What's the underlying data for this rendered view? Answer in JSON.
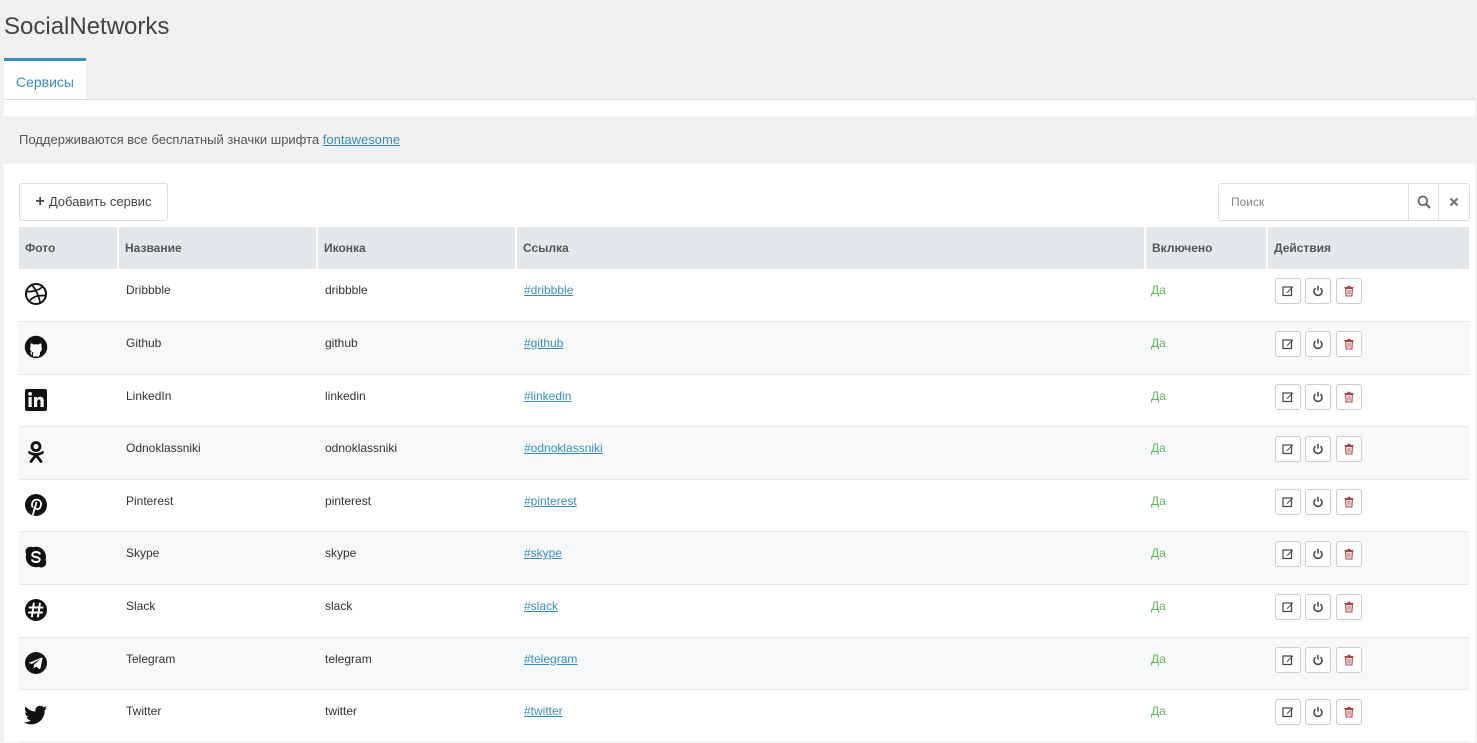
{
  "page": {
    "title": "SocialNetworks"
  },
  "tabs": [
    {
      "label": "Сервисы",
      "active": true
    }
  ],
  "notice": {
    "text": "Поддерживаются все бесплатный значки шрифта ",
    "link_text": "fontawesome"
  },
  "toolbar": {
    "add_label": "Добавить сервис",
    "search_placeholder": "Поиск"
  },
  "table": {
    "headers": [
      "Фото",
      "Название",
      "Иконка",
      "Ссылка",
      "Включено",
      "Действия"
    ],
    "rows": [
      {
        "icon": "dribbble-icon",
        "name": "Dribbble",
        "icon_name": "dribbble",
        "link": "#dribbble",
        "enabled": "Да"
      },
      {
        "icon": "github-icon",
        "name": "Github",
        "icon_name": "github",
        "link": "#github",
        "enabled": "Да"
      },
      {
        "icon": "linkedin-icon",
        "name": "LinkedIn",
        "icon_name": "linkedin",
        "link": "#linkedin",
        "enabled": "Да"
      },
      {
        "icon": "odnoklassniki-icon",
        "name": "Odnoklassniki",
        "icon_name": "odnoklassniki",
        "link": "#odnoklassniki",
        "enabled": "Да"
      },
      {
        "icon": "pinterest-icon",
        "name": "Pinterest",
        "icon_name": "pinterest",
        "link": "#pinterest",
        "enabled": "Да"
      },
      {
        "icon": "skype-icon",
        "name": "Skype",
        "icon_name": "skype",
        "link": "#skype",
        "enabled": "Да"
      },
      {
        "icon": "slack-icon",
        "name": "Slack",
        "icon_name": "slack",
        "link": "#slack",
        "enabled": "Да"
      },
      {
        "icon": "telegram-icon",
        "name": "Telegram",
        "icon_name": "telegram",
        "link": "#telegram",
        "enabled": "Да"
      },
      {
        "icon": "twitter-icon",
        "name": "Twitter",
        "icon_name": "twitter",
        "link": "#twitter",
        "enabled": "Да"
      }
    ]
  },
  "colors": {
    "accent": "#3c8dbc",
    "enabled": "#5cb85c",
    "delete": "#a94442"
  }
}
